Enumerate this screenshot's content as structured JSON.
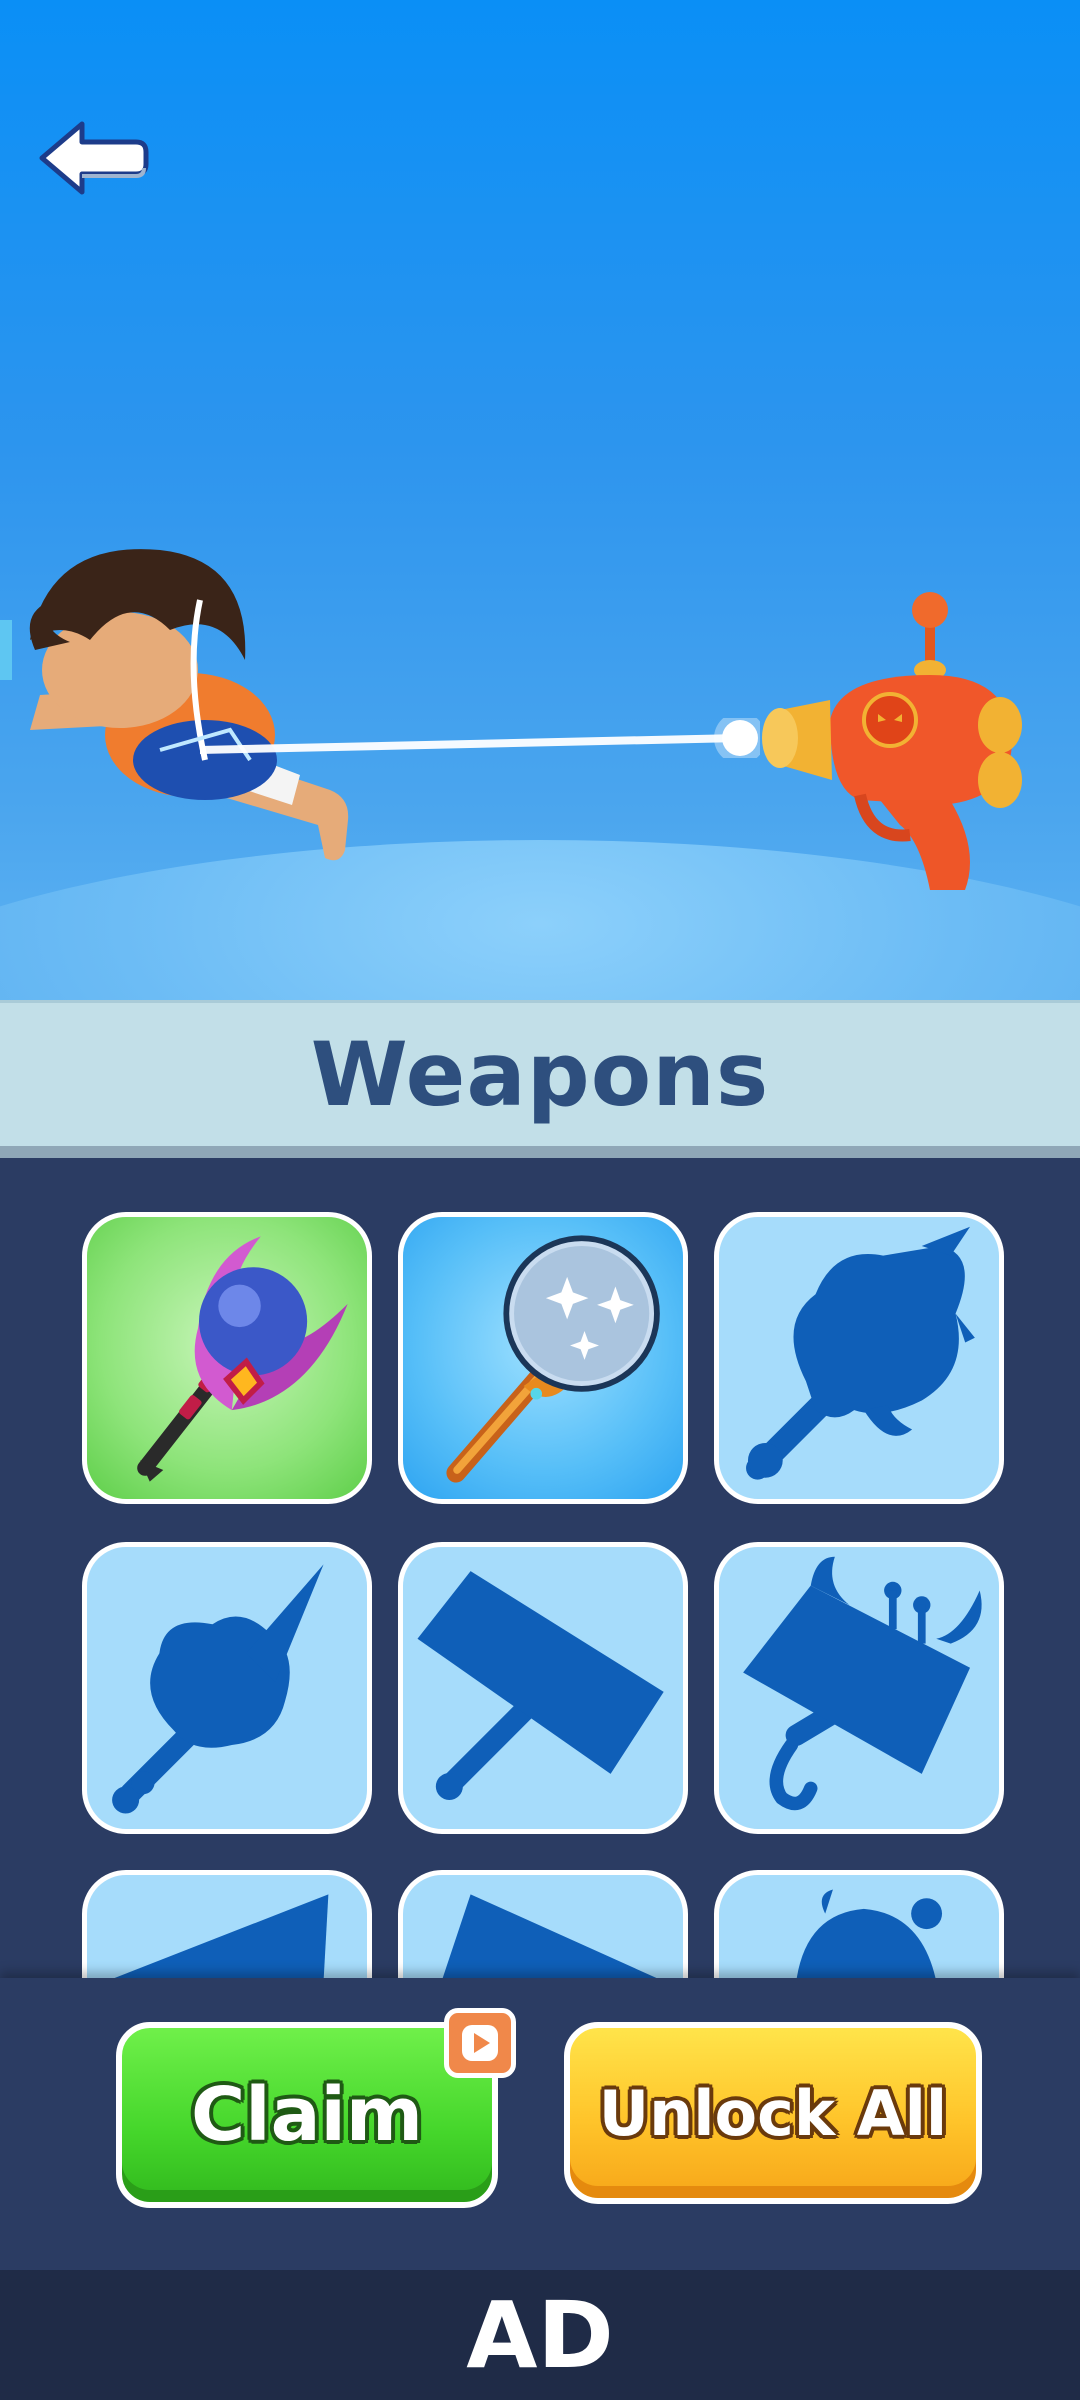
{
  "scene": {
    "back_icon": "arrow-left-icon",
    "character": "character-icon",
    "weapon": "ray-gun-icon"
  },
  "title_bar": {
    "title": "Weapons"
  },
  "grid": {
    "tiles": [
      {
        "icon": "purple-orb-staff-icon",
        "state": "owned-selected",
        "color": "#8ee47a"
      },
      {
        "icon": "bubble-wand-icon",
        "state": "owned",
        "color": "#57bff8"
      },
      {
        "icon": "locked-pirate-club-icon",
        "state": "locked"
      },
      {
        "icon": "locked-unicorn-club-icon",
        "state": "locked"
      },
      {
        "icon": "locked-hammer-icon",
        "state": "locked"
      },
      {
        "icon": "locked-robot-hammer-icon",
        "state": "locked"
      },
      {
        "icon": "locked-weapon-icon",
        "state": "locked"
      },
      {
        "icon": "locked-weapon-icon",
        "state": "locked"
      },
      {
        "icon": "locked-weapon-icon",
        "state": "locked"
      }
    ]
  },
  "buttons": {
    "claim_label": "Claim",
    "claim_badge_icon": "play-icon",
    "unlock_all_label": "Unlock All"
  },
  "ad_bar": {
    "label": "AD"
  },
  "colors": {
    "sky_top": "#0a8ff6",
    "panel": "#2b3c63",
    "title_bg": "#c2dfe8",
    "title_text": "#2e4f7e",
    "locked_tile": "#a6dcfb",
    "silhouette": "#0f5fb8",
    "claim_green": "#45d62b",
    "unlock_yellow": "#ffc42a"
  }
}
